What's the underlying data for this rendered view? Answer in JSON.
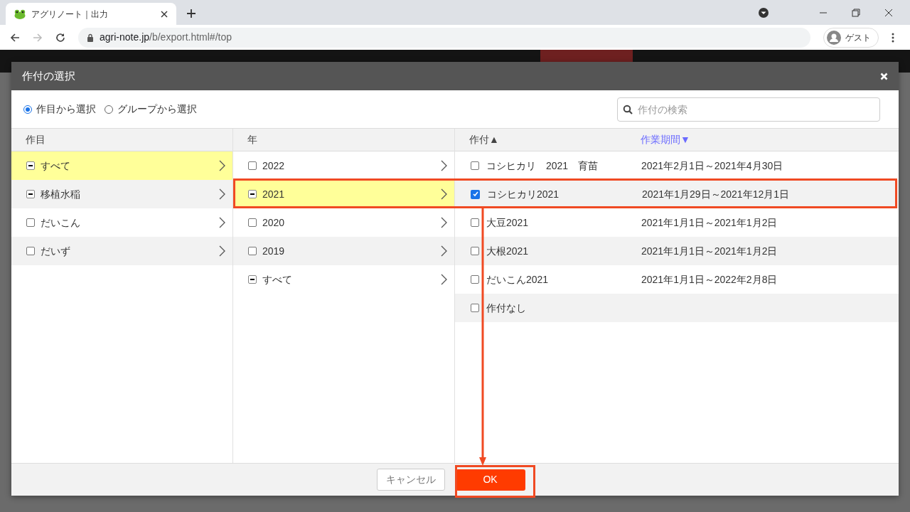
{
  "browser": {
    "tab_title": "アグリノート｜出力",
    "url_host": "agri-note.jp",
    "url_path": "/b/export.html#/top",
    "profile": "ゲスト"
  },
  "dialog": {
    "title": "作付の選択",
    "modes": [
      {
        "label": "作目から選択",
        "selected": true
      },
      {
        "label": "グループから選択",
        "selected": false
      }
    ],
    "search": {
      "placeholder": "作付の検索"
    },
    "crops": {
      "header": "作目",
      "items": [
        {
          "label": "すべて",
          "partial": true,
          "selected": true
        },
        {
          "label": "移植水稲",
          "partial": true,
          "selected": false
        },
        {
          "label": "だいこん",
          "partial": false,
          "selected": false
        },
        {
          "label": "だいず",
          "partial": false,
          "selected": false
        }
      ]
    },
    "years": {
      "header": "年",
      "items": [
        {
          "label": "2022",
          "partial": false,
          "selected": false
        },
        {
          "label": "2021",
          "partial": true,
          "selected": true
        },
        {
          "label": "2020",
          "partial": false,
          "selected": false
        },
        {
          "label": "2019",
          "partial": false,
          "selected": false
        },
        {
          "label": "すべて",
          "partial": true,
          "selected": false
        }
      ]
    },
    "plantings": {
      "columns": [
        {
          "label": "作付▲",
          "active": false
        },
        {
          "label": "作業期間▼",
          "active": true
        }
      ],
      "rows": [
        {
          "name": "コシヒカリ　2021　育苗",
          "period": "2021年2月1日～2021年4月30日",
          "checked": false
        },
        {
          "name": "コシヒカリ2021",
          "period": "2021年1月29日～2021年12月1日",
          "checked": true
        },
        {
          "name": "大豆2021",
          "period": "2021年1月1日～2021年1月2日",
          "checked": false
        },
        {
          "name": "大根2021",
          "period": "2021年1月1日～2021年1月2日",
          "checked": false
        },
        {
          "name": "だいこん2021",
          "period": "2021年1月1日～2022年2月8日",
          "checked": false
        },
        {
          "name": "作付なし",
          "checked": false
        }
      ]
    },
    "buttons": [
      {
        "label": "キャンセル",
        "kind": "secondary"
      },
      {
        "label": "OK",
        "kind": "primary"
      }
    ]
  },
  "annotations": [
    {
      "kind": "row-frame"
    },
    {
      "kind": "arrow"
    },
    {
      "kind": "button-frame"
    }
  ]
}
